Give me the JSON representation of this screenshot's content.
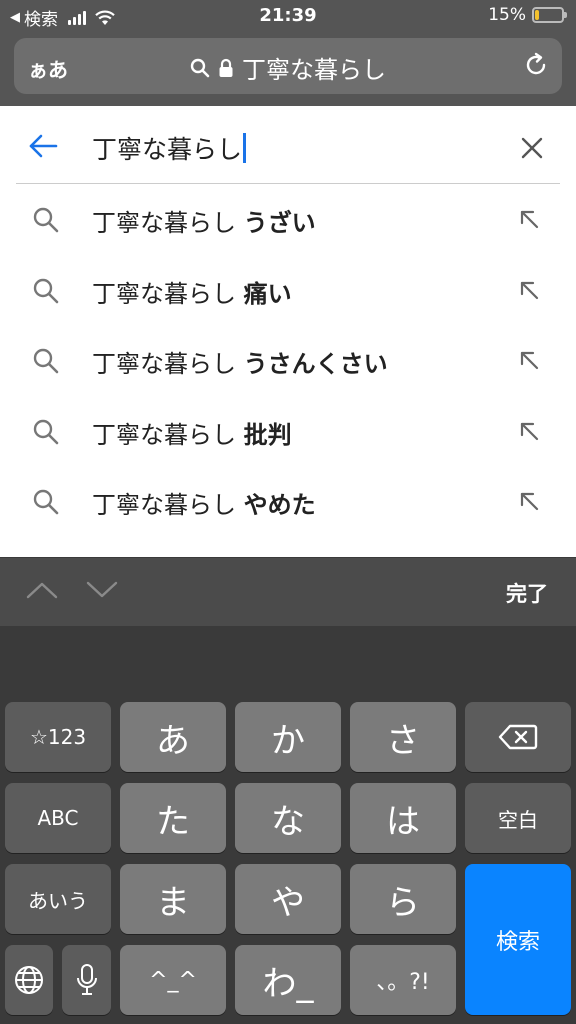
{
  "status": {
    "back_label": "検索",
    "time": "21:39",
    "battery": "15%",
    "battery_level": 0.15
  },
  "browser": {
    "aa_label": "ぁあ",
    "url_text": "丁寧な暮らし"
  },
  "search": {
    "query": "丁寧な暮らし"
  },
  "suggestions": [
    {
      "prefix": "丁寧な暮らし ",
      "suffix": "うざい"
    },
    {
      "prefix": "丁寧な暮らし ",
      "suffix": "痛い"
    },
    {
      "prefix": "丁寧な暮らし ",
      "suffix": "うさんくさい"
    },
    {
      "prefix": "丁寧な暮らし ",
      "suffix": "批判"
    },
    {
      "prefix": "丁寧な暮らし ",
      "suffix": "やめた"
    }
  ],
  "accessory": {
    "done_label": "完了"
  },
  "keyboard": {
    "row1": [
      "☆123",
      "あ",
      "か",
      "さ"
    ],
    "row2": [
      "ABC",
      "た",
      "な",
      "は",
      "空白"
    ],
    "row3": [
      "あいう",
      "ま",
      "や",
      "ら"
    ],
    "row4": [
      "^_^",
      "わ_",
      "、。?!"
    ],
    "search_key": "検索"
  },
  "colors": {
    "accent": "#1a73e8",
    "search_key": "#0a84ff",
    "battery": "#f2c12e"
  }
}
